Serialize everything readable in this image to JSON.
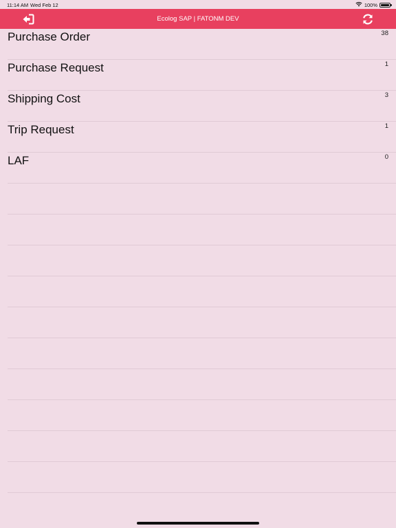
{
  "status_bar": {
    "time": "11:14 AM",
    "date": "Wed Feb 12",
    "battery": "100%"
  },
  "header": {
    "title": "Ecolog SAP | FATONM DEV",
    "back_icon": "sign-out-icon",
    "refresh_icon": "refresh-icon",
    "color": "#e8405f"
  },
  "list": {
    "items": [
      {
        "label": "Purchase Order",
        "count": "38"
      },
      {
        "label": "Purchase Request",
        "count": "1"
      },
      {
        "label": "Shipping Cost",
        "count": "3"
      },
      {
        "label": "Trip Request",
        "count": "1"
      },
      {
        "label": "LAF",
        "count": "0"
      }
    ],
    "empty_rows": 10
  },
  "background": "#f1dce6"
}
